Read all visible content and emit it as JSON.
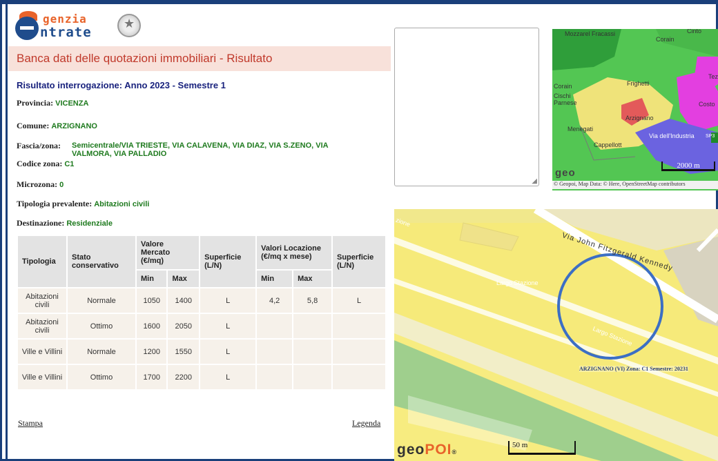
{
  "header": {
    "logo_top": "genzia",
    "logo_bottom": "ntrate",
    "banner_title": "Banca dati delle quotazioni immobiliari - Risultato"
  },
  "result": {
    "heading": "Risultato interrogazione: Anno 2023 - Semestre 1",
    "provincia_label": "Provincia:",
    "provincia_value": "VICENZA",
    "comune_label": "Comune:",
    "comune_value": "ARZIGNANO",
    "fascia_label": "Fascia/zona:",
    "fascia_value": "Semicentrale/VIA TRIESTE, VIA CALAVENA, VIA DIAZ, VIA S.ZENO, VIA VALMORA, VIA PALLADIO",
    "codice_label": "Codice zona:",
    "codice_value": "C1",
    "microzona_label": "Microzona:",
    "microzona_value": "0",
    "tipologia_label": "Tipologia prevalente:",
    "tipologia_value": "Abitazioni civili",
    "destinazione_label": "Destinazione:",
    "destinazione_value": "Residenziale"
  },
  "table": {
    "headers": {
      "tipologia": "Tipologia",
      "stato": "Stato conservativo",
      "valore_mercato": "Valore Mercato (€/mq)",
      "superficie1": "Superficie (L/N)",
      "valori_locazione": "Valori Locazione (€/mq x mese)",
      "superficie2": "Superficie (L/N)",
      "min": "Min",
      "max": "Max"
    },
    "rows": [
      {
        "tipologia": "Abitazioni civili",
        "stato": "Normale",
        "vm_min": "1050",
        "vm_max": "1400",
        "sup1": "L",
        "vl_min": "4,2",
        "vl_max": "5,8",
        "sup2": "L"
      },
      {
        "tipologia": "Abitazioni civili",
        "stato": "Ottimo",
        "vm_min": "1600",
        "vm_max": "2050",
        "sup1": "L",
        "vl_min": "",
        "vl_max": "",
        "sup2": ""
      },
      {
        "tipologia": "Ville e Villini",
        "stato": "Normale",
        "vm_min": "1200",
        "vm_max": "1550",
        "sup1": "L",
        "vl_min": "",
        "vl_max": "",
        "sup2": ""
      },
      {
        "tipologia": "Ville e Villini",
        "stato": "Ottimo",
        "vm_min": "1700",
        "vm_max": "2200",
        "sup1": "L",
        "vl_min": "",
        "vl_max": "",
        "sup2": ""
      }
    ]
  },
  "links": {
    "stampa": "Stampa",
    "legenda": "Legenda"
  },
  "small_map": {
    "labels": [
      "Mozzarel Fracassi",
      "Corain",
      "Corain",
      "Cischi Parnese",
      "Frighetti",
      "Costo",
      "Arzignano",
      "Menegati",
      "Cappellott",
      "Via dell'Industria",
      "Tez",
      "SP3",
      "Cinto"
    ],
    "scale": "2000 m",
    "attribution": "© Geopoi, Map Data: © Here, OpenStreetMap contributors",
    "logo_text": "geo"
  },
  "big_map": {
    "labels": {
      "via": "Via John Fitzgerald Kennedy",
      "largo1": "Largo Stazione",
      "largo2": "Largo Stazione",
      "zione": "zione"
    },
    "zone_label": "ARZIGNANO (VI) Zona: C1 Semestre: 20231",
    "logo_geo": "geo",
    "logo_poi": "POI",
    "logo_mark": "®",
    "scale": "50 m"
  },
  "colors": {
    "banner_bg": "#f8e1da",
    "banner_text": "#c0392b",
    "value_green": "#1e7a1e",
    "frame_blue": "#1a3f7a"
  }
}
